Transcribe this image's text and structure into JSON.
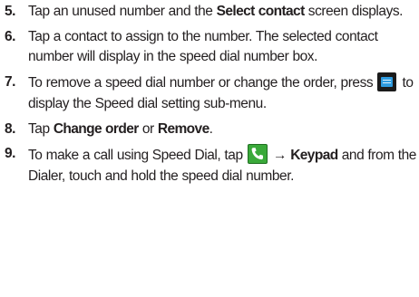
{
  "steps": [
    {
      "number": "5.",
      "parts": [
        "Tap an unused number and the ",
        "Select contact",
        " screen displays."
      ]
    },
    {
      "number": "6.",
      "text": "Tap a contact to assign to the number. The selected contact number will display in the speed dial number box."
    },
    {
      "number": "7.",
      "parts": [
        "To remove a speed dial number or change the order, press ",
        " to display the Speed dial setting sub-menu."
      ],
      "icon": "menu-icon"
    },
    {
      "number": "8.",
      "parts": [
        "Tap ",
        "Change order",
        " or ",
        "Remove",
        "."
      ]
    },
    {
      "number": "9.",
      "parts": [
        "To make a call using Speed Dial, tap ",
        "→",
        "Keypad",
        " and from the Dialer, touch and hold the speed dial number."
      ],
      "icon": "phone-icon"
    }
  ],
  "colors": {
    "text": "#231f20",
    "menu_icon_bg": "#1b1b1b",
    "menu_icon_accent": "#2f9ce0",
    "phone_icon_bg": "#3aa93a"
  }
}
